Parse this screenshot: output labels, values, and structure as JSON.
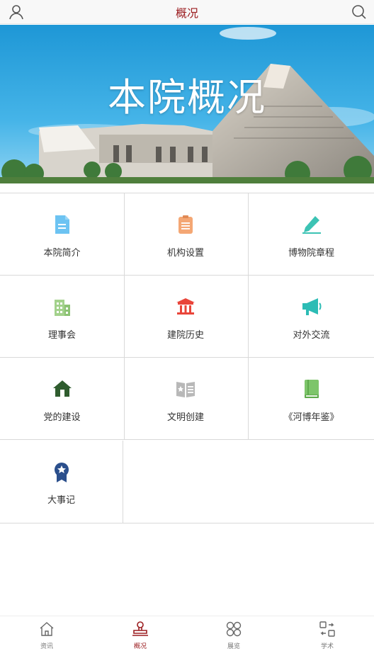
{
  "header": {
    "title": "概况"
  },
  "banner": {
    "caption": "本院概况"
  },
  "grid": {
    "items": [
      {
        "label": "本院简介",
        "icon": "document-icon",
        "color": "#6cc3f2"
      },
      {
        "label": "机构设置",
        "icon": "clipboard-icon",
        "color": "#f4a774"
      },
      {
        "label": "博物院章程",
        "icon": "pencil-icon",
        "color": "#3cc3b4"
      },
      {
        "label": "理事会",
        "icon": "building-icon",
        "color": "#a3d18c"
      },
      {
        "label": "建院历史",
        "icon": "temple-icon",
        "color": "#e9453a"
      },
      {
        "label": "对外交流",
        "icon": "megaphone-icon",
        "color": "#2cbcb5"
      },
      {
        "label": "党的建设",
        "icon": "home-icon",
        "color": "#2f5c2e"
      },
      {
        "label": "文明创建",
        "icon": "newspaper-icon",
        "color": "#b8b8b8"
      },
      {
        "label": "《河博年鉴》",
        "icon": "book-icon",
        "color": "#7dc56a"
      },
      {
        "label": "大事记",
        "icon": "award-ribbon-icon",
        "color": "#2b4f8c"
      }
    ]
  },
  "tabbar": {
    "tabs": [
      {
        "label": "资讯",
        "icon": "house-outline-icon"
      },
      {
        "label": "概况",
        "icon": "stamp-icon",
        "active": true
      },
      {
        "label": "展览",
        "icon": "four-circles-icon"
      },
      {
        "label": "学术",
        "icon": "exchange-shapes-icon"
      }
    ]
  },
  "colors": {
    "accent": "#9b1d20",
    "divider": "#d9d9d9"
  }
}
